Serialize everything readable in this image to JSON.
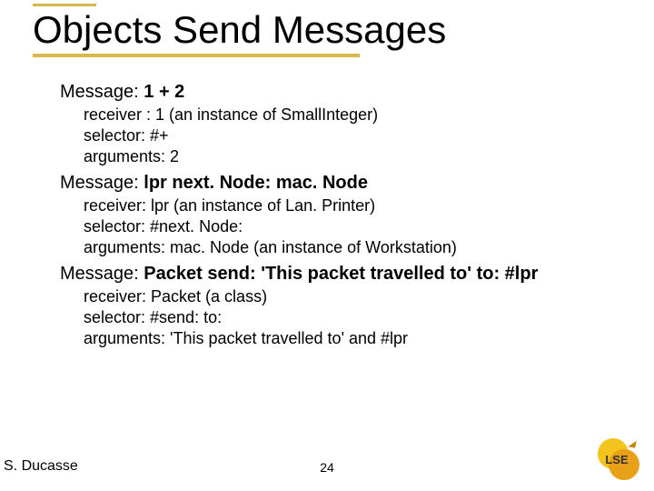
{
  "title": "Objects Send Messages",
  "messages": [
    {
      "label": "Message: ",
      "expr": "1 + 2",
      "receiver": "receiver : 1 (an instance of SmallInteger)",
      "selector": "selector: #+",
      "arguments": "arguments: 2"
    },
    {
      "label": "Message:  ",
      "expr": "lpr next. Node: mac. Node",
      "receiver": "receiver: lpr (an instance of Lan. Printer)",
      "selector": "selector: #next. Node:",
      "arguments": "arguments: mac. Node (an instance of Workstation)"
    },
    {
      "label": "Message: ",
      "expr": "Packet send: 'This packet travelled to' to: #lpr",
      "receiver": "receiver: Packet (a class)",
      "selector": "selector: #send: to:",
      "arguments": "arguments: 'This packet travelled to' and #lpr"
    }
  ],
  "author": "S. Ducasse",
  "page_number": "24",
  "logo_text": "LSE"
}
